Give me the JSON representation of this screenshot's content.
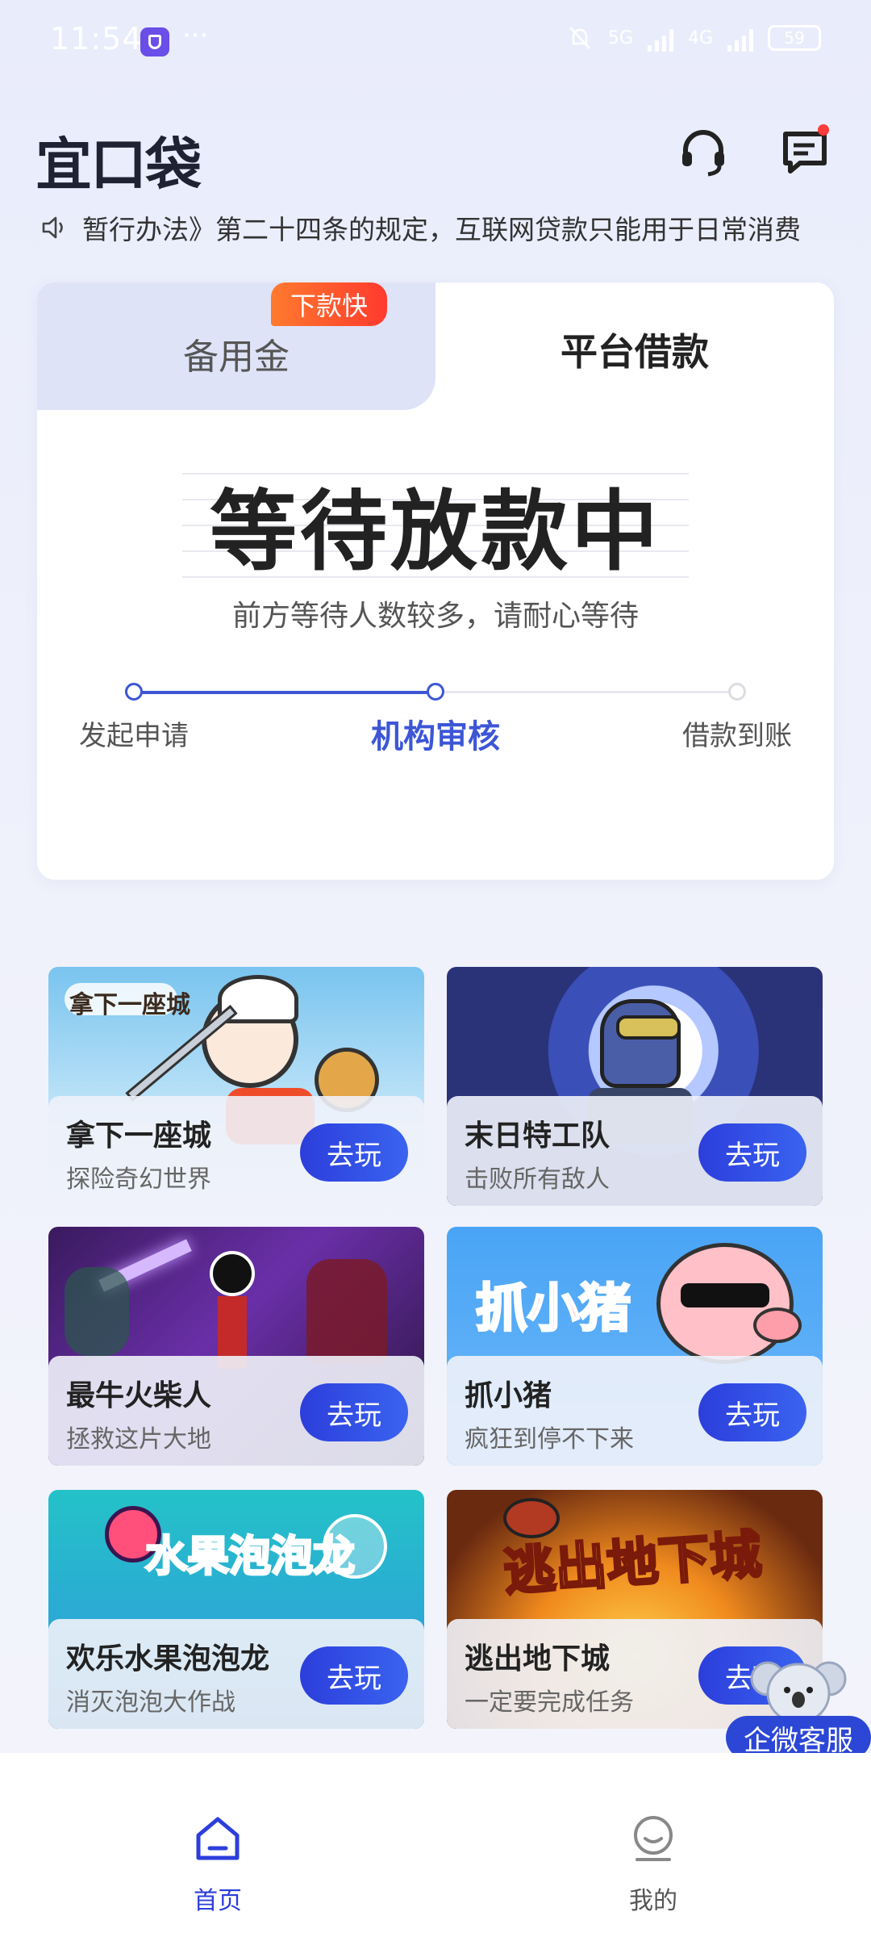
{
  "status_bar": {
    "time": "11:54",
    "net_5g": "5G",
    "net_4g": "4G",
    "battery": "59"
  },
  "header": {
    "logo": "宜口袋"
  },
  "notice": {
    "text": "暂行办法》第二十四条的规定，互联网贷款只能用于日常消费"
  },
  "tabs": {
    "left_label": "备用金",
    "left_badge": "下款快",
    "right_label": "平台借款"
  },
  "loan_status": {
    "title": "等待放款中",
    "subtitle": "前方等待人数较多，请耐心等待",
    "steps": [
      "发起申请",
      "机构审核",
      "借款到账"
    ],
    "current_step": 2
  },
  "games": [
    {
      "name": "拿下一座城",
      "desc": "探险奇幻世界",
      "button": "去玩",
      "art_text": "拿下一座城"
    },
    {
      "name": "末日特工队",
      "desc": "击败所有敌人",
      "button": "去玩"
    },
    {
      "name": "最牛火柴人",
      "desc": "拯救这片大地",
      "button": "去玩"
    },
    {
      "name": "抓小猪",
      "desc": "疯狂到停不下来",
      "button": "去玩",
      "art_text": "抓小猪"
    },
    {
      "name": "欢乐水果泡泡龙",
      "desc": "消灭泡泡大作战",
      "button": "去玩",
      "art_text": "水果泡泡龙"
    },
    {
      "name": "逃出地下城",
      "desc": "一定要完成任务",
      "button": "去玩",
      "art_text": "逃出地下城"
    }
  ],
  "floating": {
    "cs_label": "企微客服"
  },
  "bottom_nav": {
    "home": "首页",
    "mine": "我的",
    "active_color": "#2c3edb"
  },
  "colors": {
    "accent": "#3c56d6",
    "badge": "#ff4a2e"
  }
}
